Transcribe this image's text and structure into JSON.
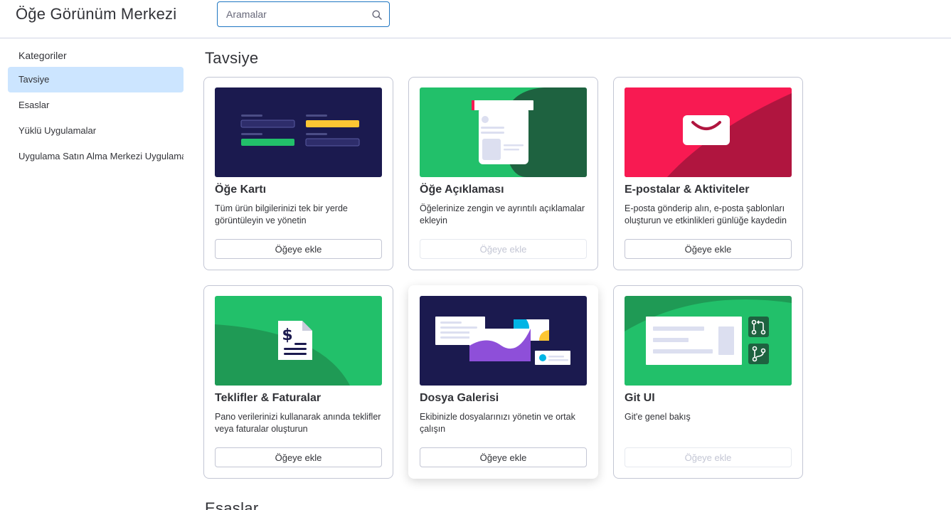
{
  "header": {
    "title": "Öğe Görünüm Merkezi",
    "search_placeholder": "Aramalar"
  },
  "sidebar": {
    "heading": "Kategoriler",
    "items": [
      {
        "label": "Tavsiye",
        "active": true
      },
      {
        "label": "Esaslar",
        "active": false
      },
      {
        "label": "Yüklü Uygulamalar",
        "active": false
      },
      {
        "label": "Uygulama Satın Alma Merkezi Uygulamaları",
        "active": false
      }
    ]
  },
  "sections": [
    {
      "title": "Tavsiye"
    },
    {
      "title": "Esaslar"
    }
  ],
  "cards": [
    {
      "title": "Öğe Kartı",
      "description": "Tüm ürün bilgilerinizi tek bir yerde görüntüleyin ve yönetin",
      "button": "Öğeye ekle",
      "button_enabled": true,
      "icon": "item-card-illustration"
    },
    {
      "title": "Öğe Açıklaması",
      "description": "Öğelerinize zengin ve ayrıntılı açıklamalar ekleyin",
      "button": "Öğeye ekle",
      "button_enabled": false,
      "icon": "item-description-illustration"
    },
    {
      "title": "E-postalar & Aktiviteler",
      "description": "E-posta gönderip alın, e-posta şablonları oluşturun ve etkinlikleri günlüğe kaydedin",
      "button": "Öğeye ekle",
      "button_enabled": true,
      "icon": "email-envelope-icon"
    },
    {
      "title": "Teklifler & Faturalar",
      "description": "Pano verilerinizi kullanarak anında teklifler veya faturalar oluşturun",
      "button": "Öğeye ekle",
      "button_enabled": true,
      "icon": "invoice-dollar-icon"
    },
    {
      "title": "Dosya Galerisi",
      "description": "Ekibinizle dosyalarınızı yönetin ve ortak çalışın",
      "button": "Öğeye ekle",
      "button_enabled": true,
      "icon": "file-gallery-illustration"
    },
    {
      "title": "Git UI",
      "description": "Git'e genel bakış",
      "button": "Öğeye ekle",
      "button_enabled": false,
      "icon": "git-branch-icon"
    }
  ],
  "colors": {
    "accent": "#1f76c2",
    "selected_bg": "#cce5ff",
    "navy": "#1b1a4f",
    "green": "#22c06a",
    "dark_green": "#1e6240",
    "crimson": "#b0153f",
    "pink": "#f81a52",
    "purple": "#8e4fd9",
    "yellow": "#fdc633"
  }
}
